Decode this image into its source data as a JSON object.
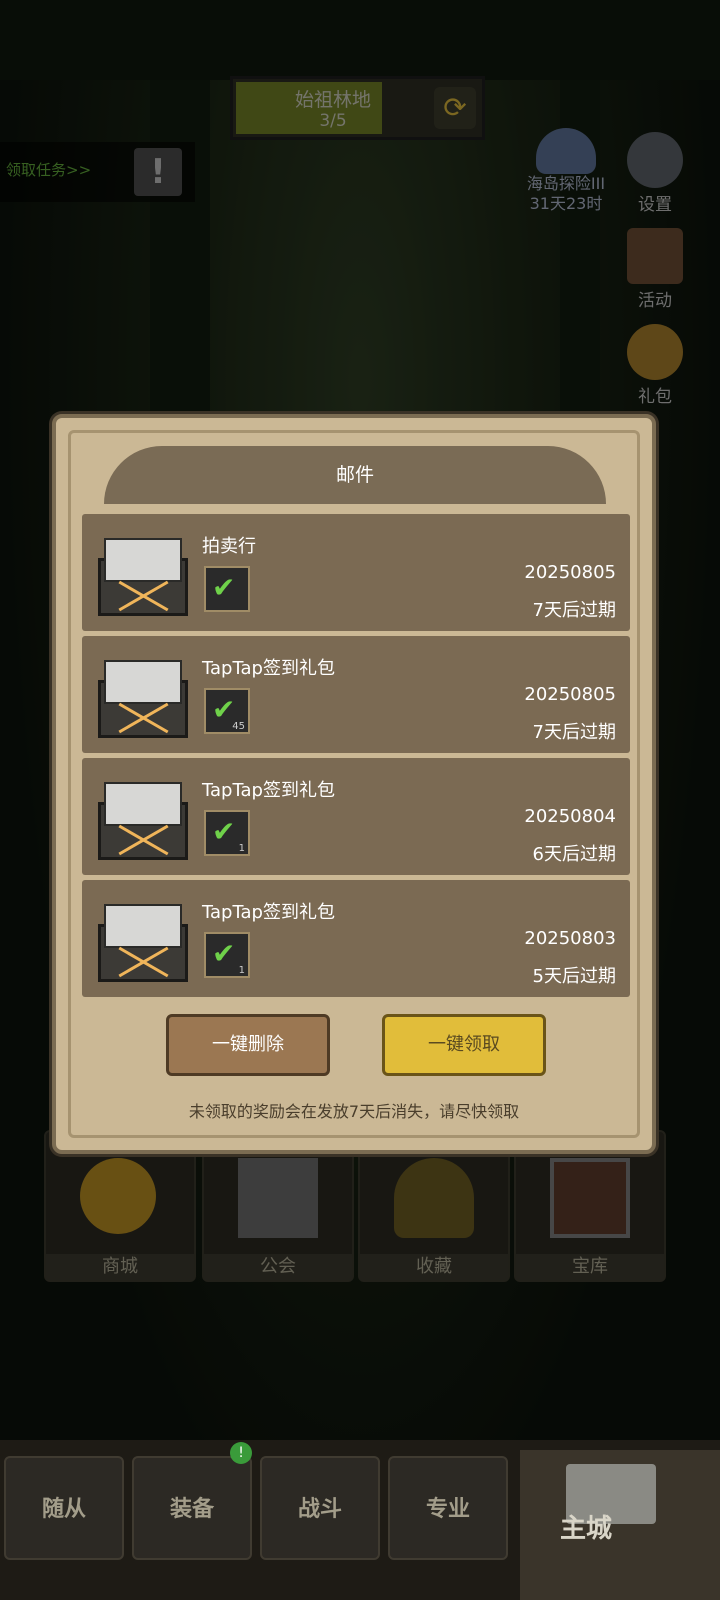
{
  "top": {
    "quest": {
      "title": "始祖林地",
      "progress": "3/5",
      "refresh_icon": "refresh-icon",
      "fill_fraction": 0.6
    },
    "claim_task_label": "领取任务>>",
    "alert_icon": "exclamation-icon"
  },
  "side": {
    "event": {
      "name": "海岛探险III",
      "timer": "31天23时"
    },
    "settings": "设置",
    "activity": "活动",
    "gift": "礼包"
  },
  "grid": [
    "商城",
    "公会",
    "收藏",
    "宝库"
  ],
  "nav": {
    "tabs": [
      "随从",
      "装备",
      "战斗",
      "专业"
    ],
    "home": "主城",
    "badge": "!"
  },
  "dialog": {
    "title": "邮件",
    "mails": [
      {
        "title": "拍卖行",
        "date": "20250805",
        "expire": "7天后过期",
        "count": ""
      },
      {
        "title": "TapTap签到礼包",
        "date": "20250805",
        "expire": "7天后过期",
        "count": "45"
      },
      {
        "title": "TapTap签到礼包",
        "date": "20250804",
        "expire": "6天后过期",
        "count": "1"
      },
      {
        "title": "TapTap签到礼包",
        "date": "20250803",
        "expire": "5天后过期",
        "count": "1"
      }
    ],
    "delete_all": "一键删除",
    "claim_all": "一键领取",
    "note": "未领取的奖励会在发放7天后消失，请尽快领取"
  },
  "colors": {
    "accent_gold": "#e1bd3a",
    "panel": "#cbb895",
    "mail_row": "#7b6a53",
    "task_green": "#5fa63a"
  }
}
